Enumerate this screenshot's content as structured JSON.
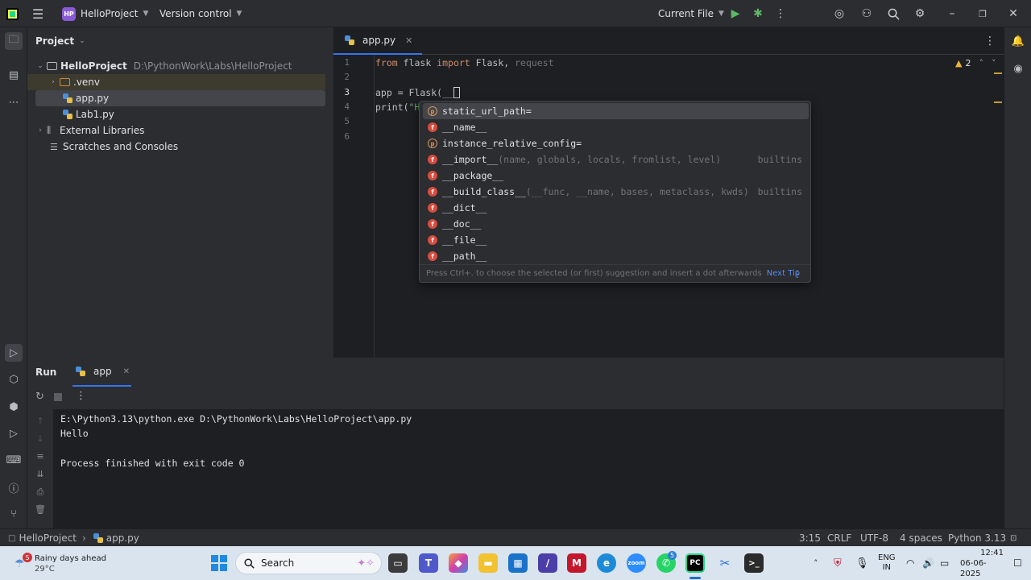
{
  "titlebar": {
    "project_badge": "HP",
    "project_name": "HelloProject",
    "vcs_label": "Version control",
    "run_config": "Current File"
  },
  "project_panel": {
    "title": "Project",
    "tree": [
      {
        "label": "HelloProject",
        "path": "D:\\PythonWork\\Labs\\HelloProject"
      },
      {
        "label": ".venv"
      },
      {
        "label": "app.py"
      },
      {
        "label": "Lab1.py"
      },
      {
        "label": "External Libraries"
      },
      {
        "label": "Scratches and Consoles"
      }
    ]
  },
  "editor": {
    "tab_label": "app.py",
    "warnings_count": "2",
    "line_numbers": [
      "1",
      "2",
      "3",
      "4",
      "5",
      "6"
    ],
    "lines": {
      "l1_kw1": "from",
      "l1_mod": " flask ",
      "l1_kw2": "import",
      "l1_rest": " Flask, ",
      "l1_dim": "request",
      "l3_pre": "app = Flask(",
      "l3_arg": "__",
      "l4_pre": "print(",
      "l4_str": "\"H"
    }
  },
  "completion": {
    "items": [
      {
        "icon": "p",
        "name": "static_url_path=",
        "sig": "",
        "src": ""
      },
      {
        "icon": "f",
        "name": "__name__",
        "sig": "",
        "src": ""
      },
      {
        "icon": "p",
        "name": "instance_relative_config=",
        "sig": "",
        "src": ""
      },
      {
        "icon": "f",
        "name": "__import__",
        "sig": "(name, globals, locals, fromlist, level)",
        "src": "builtins"
      },
      {
        "icon": "f",
        "name": "__package__",
        "sig": "",
        "src": ""
      },
      {
        "icon": "f",
        "name": "__build_class__",
        "sig": "(__func, __name, bases, metaclass, kwds)",
        "src": "builtins"
      },
      {
        "icon": "f",
        "name": "__dict__",
        "sig": "",
        "src": ""
      },
      {
        "icon": "f",
        "name": "__doc__",
        "sig": "",
        "src": ""
      },
      {
        "icon": "f",
        "name": "__file__",
        "sig": "",
        "src": ""
      },
      {
        "icon": "f",
        "name": "__path__",
        "sig": "",
        "src": ""
      }
    ],
    "footer_text": "Press Ctrl+. to choose the selected (or first) suggestion and insert a dot afterwards",
    "footer_tip": "Next Tip"
  },
  "run_panel": {
    "title": "Run",
    "tab_label": "app",
    "console_lines": [
      "E:\\Python3.13\\python.exe D:\\PythonWork\\Labs\\HelloProject\\app.py",
      "Hello",
      "",
      "Process finished with exit code 0"
    ]
  },
  "statusbar": {
    "breadcrumb_project": "HelloProject",
    "breadcrumb_file": "app.py",
    "position": "3:15",
    "line_ending": "CRLF",
    "encoding": "UTF-8",
    "indent": "4 spaces",
    "interpreter": "Python 3.13"
  },
  "taskbar": {
    "weather_badge": "5",
    "weather_title": "Rainy days ahead",
    "weather_temp": "29°C",
    "search_placeholder": "Search",
    "zoom_badge": "5",
    "lang_top": "ENG",
    "lang_bottom": "IN",
    "time": "12:41",
    "date": "06-06-2025"
  }
}
